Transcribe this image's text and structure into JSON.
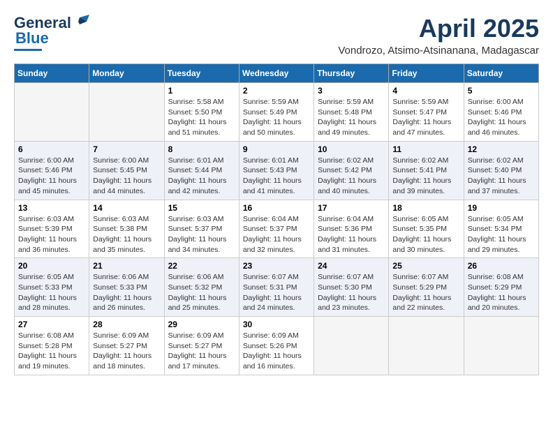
{
  "logo": {
    "line1": "General",
    "line2": "Blue"
  },
  "title": "April 2025",
  "location": "Vondrozo, Atsimo-Atsinanana, Madagascar",
  "weekdays": [
    "Sunday",
    "Monday",
    "Tuesday",
    "Wednesday",
    "Thursday",
    "Friday",
    "Saturday"
  ],
  "weeks": [
    [
      {
        "day": "",
        "info": ""
      },
      {
        "day": "",
        "info": ""
      },
      {
        "day": "1",
        "info": "Sunrise: 5:58 AM\nSunset: 5:50 PM\nDaylight: 11 hours and 51 minutes."
      },
      {
        "day": "2",
        "info": "Sunrise: 5:59 AM\nSunset: 5:49 PM\nDaylight: 11 hours and 50 minutes."
      },
      {
        "day": "3",
        "info": "Sunrise: 5:59 AM\nSunset: 5:48 PM\nDaylight: 11 hours and 49 minutes."
      },
      {
        "day": "4",
        "info": "Sunrise: 5:59 AM\nSunset: 5:47 PM\nDaylight: 11 hours and 47 minutes."
      },
      {
        "day": "5",
        "info": "Sunrise: 6:00 AM\nSunset: 5:46 PM\nDaylight: 11 hours and 46 minutes."
      }
    ],
    [
      {
        "day": "6",
        "info": "Sunrise: 6:00 AM\nSunset: 5:46 PM\nDaylight: 11 hours and 45 minutes."
      },
      {
        "day": "7",
        "info": "Sunrise: 6:00 AM\nSunset: 5:45 PM\nDaylight: 11 hours and 44 minutes."
      },
      {
        "day": "8",
        "info": "Sunrise: 6:01 AM\nSunset: 5:44 PM\nDaylight: 11 hours and 42 minutes."
      },
      {
        "day": "9",
        "info": "Sunrise: 6:01 AM\nSunset: 5:43 PM\nDaylight: 11 hours and 41 minutes."
      },
      {
        "day": "10",
        "info": "Sunrise: 6:02 AM\nSunset: 5:42 PM\nDaylight: 11 hours and 40 minutes."
      },
      {
        "day": "11",
        "info": "Sunrise: 6:02 AM\nSunset: 5:41 PM\nDaylight: 11 hours and 39 minutes."
      },
      {
        "day": "12",
        "info": "Sunrise: 6:02 AM\nSunset: 5:40 PM\nDaylight: 11 hours and 37 minutes."
      }
    ],
    [
      {
        "day": "13",
        "info": "Sunrise: 6:03 AM\nSunset: 5:39 PM\nDaylight: 11 hours and 36 minutes."
      },
      {
        "day": "14",
        "info": "Sunrise: 6:03 AM\nSunset: 5:38 PM\nDaylight: 11 hours and 35 minutes."
      },
      {
        "day": "15",
        "info": "Sunrise: 6:03 AM\nSunset: 5:37 PM\nDaylight: 11 hours and 34 minutes."
      },
      {
        "day": "16",
        "info": "Sunrise: 6:04 AM\nSunset: 5:37 PM\nDaylight: 11 hours and 32 minutes."
      },
      {
        "day": "17",
        "info": "Sunrise: 6:04 AM\nSunset: 5:36 PM\nDaylight: 11 hours and 31 minutes."
      },
      {
        "day": "18",
        "info": "Sunrise: 6:05 AM\nSunset: 5:35 PM\nDaylight: 11 hours and 30 minutes."
      },
      {
        "day": "19",
        "info": "Sunrise: 6:05 AM\nSunset: 5:34 PM\nDaylight: 11 hours and 29 minutes."
      }
    ],
    [
      {
        "day": "20",
        "info": "Sunrise: 6:05 AM\nSunset: 5:33 PM\nDaylight: 11 hours and 28 minutes."
      },
      {
        "day": "21",
        "info": "Sunrise: 6:06 AM\nSunset: 5:33 PM\nDaylight: 11 hours and 26 minutes."
      },
      {
        "day": "22",
        "info": "Sunrise: 6:06 AM\nSunset: 5:32 PM\nDaylight: 11 hours and 25 minutes."
      },
      {
        "day": "23",
        "info": "Sunrise: 6:07 AM\nSunset: 5:31 PM\nDaylight: 11 hours and 24 minutes."
      },
      {
        "day": "24",
        "info": "Sunrise: 6:07 AM\nSunset: 5:30 PM\nDaylight: 11 hours and 23 minutes."
      },
      {
        "day": "25",
        "info": "Sunrise: 6:07 AM\nSunset: 5:29 PM\nDaylight: 11 hours and 22 minutes."
      },
      {
        "day": "26",
        "info": "Sunrise: 6:08 AM\nSunset: 5:29 PM\nDaylight: 11 hours and 20 minutes."
      }
    ],
    [
      {
        "day": "27",
        "info": "Sunrise: 6:08 AM\nSunset: 5:28 PM\nDaylight: 11 hours and 19 minutes."
      },
      {
        "day": "28",
        "info": "Sunrise: 6:09 AM\nSunset: 5:27 PM\nDaylight: 11 hours and 18 minutes."
      },
      {
        "day": "29",
        "info": "Sunrise: 6:09 AM\nSunset: 5:27 PM\nDaylight: 11 hours and 17 minutes."
      },
      {
        "day": "30",
        "info": "Sunrise: 6:09 AM\nSunset: 5:26 PM\nDaylight: 11 hours and 16 minutes."
      },
      {
        "day": "",
        "info": ""
      },
      {
        "day": "",
        "info": ""
      },
      {
        "day": "",
        "info": ""
      }
    ]
  ]
}
